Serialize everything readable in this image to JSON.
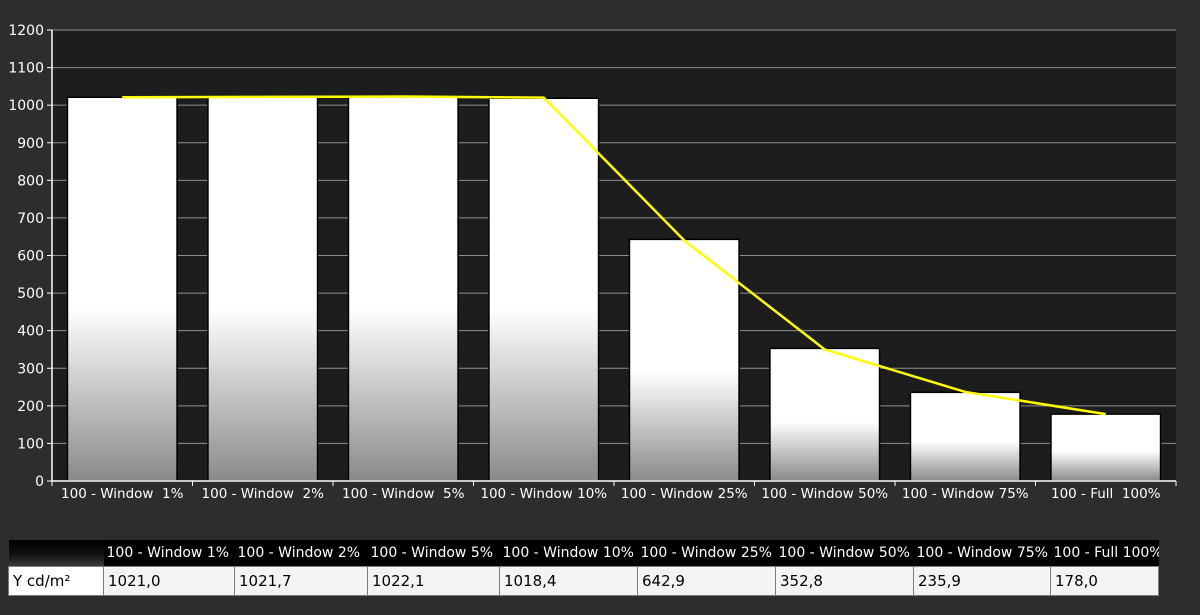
{
  "chart_data": {
    "type": "bar",
    "categories": [
      "100 - Window  1%",
      "100 - Window  2%",
      "100 - Window  5%",
      "100 - Window 10%",
      "100 - Window 25%",
      "100 - Window 50%",
      "100 - Window 75%",
      "100 - Full  100%"
    ],
    "values": [
      1021.0,
      1021.7,
      1022.1,
      1018.4,
      642.9,
      352.8,
      235.9,
      178.0
    ],
    "line": {
      "color": "#ffff00",
      "values": [
        1021,
        1022,
        1023,
        1020,
        640,
        350,
        237,
        178
      ]
    },
    "ylim": [
      0,
      1200
    ],
    "yticks": [
      0,
      100,
      200,
      300,
      400,
      500,
      600,
      700,
      800,
      900,
      1000,
      1100,
      1200
    ],
    "grid": true,
    "title": "",
    "xlabel": "",
    "ylabel": "",
    "colors": {
      "plot_background": "#1d1d1d",
      "page_background": "#2d2d2d",
      "bar_top": "#ffffff",
      "bar_bottom": "#8a8a8a",
      "grid": "#8f8f8f",
      "line": "#ffff00"
    }
  },
  "table": {
    "row_label": "Y cd/m²",
    "headers": [
      "100 - Window  1%",
      "100 - Window  2%",
      "100 - Window  5%",
      "100 - Window 10%",
      "100 - Window 25%",
      "100 - Window 50%",
      "100 - Window 75%",
      "100 - Full  100%"
    ],
    "values": [
      "1021,0",
      "1021,7",
      "1022,1",
      "1018,4",
      "642,9",
      "352,8",
      "235,9",
      "178,0"
    ]
  }
}
